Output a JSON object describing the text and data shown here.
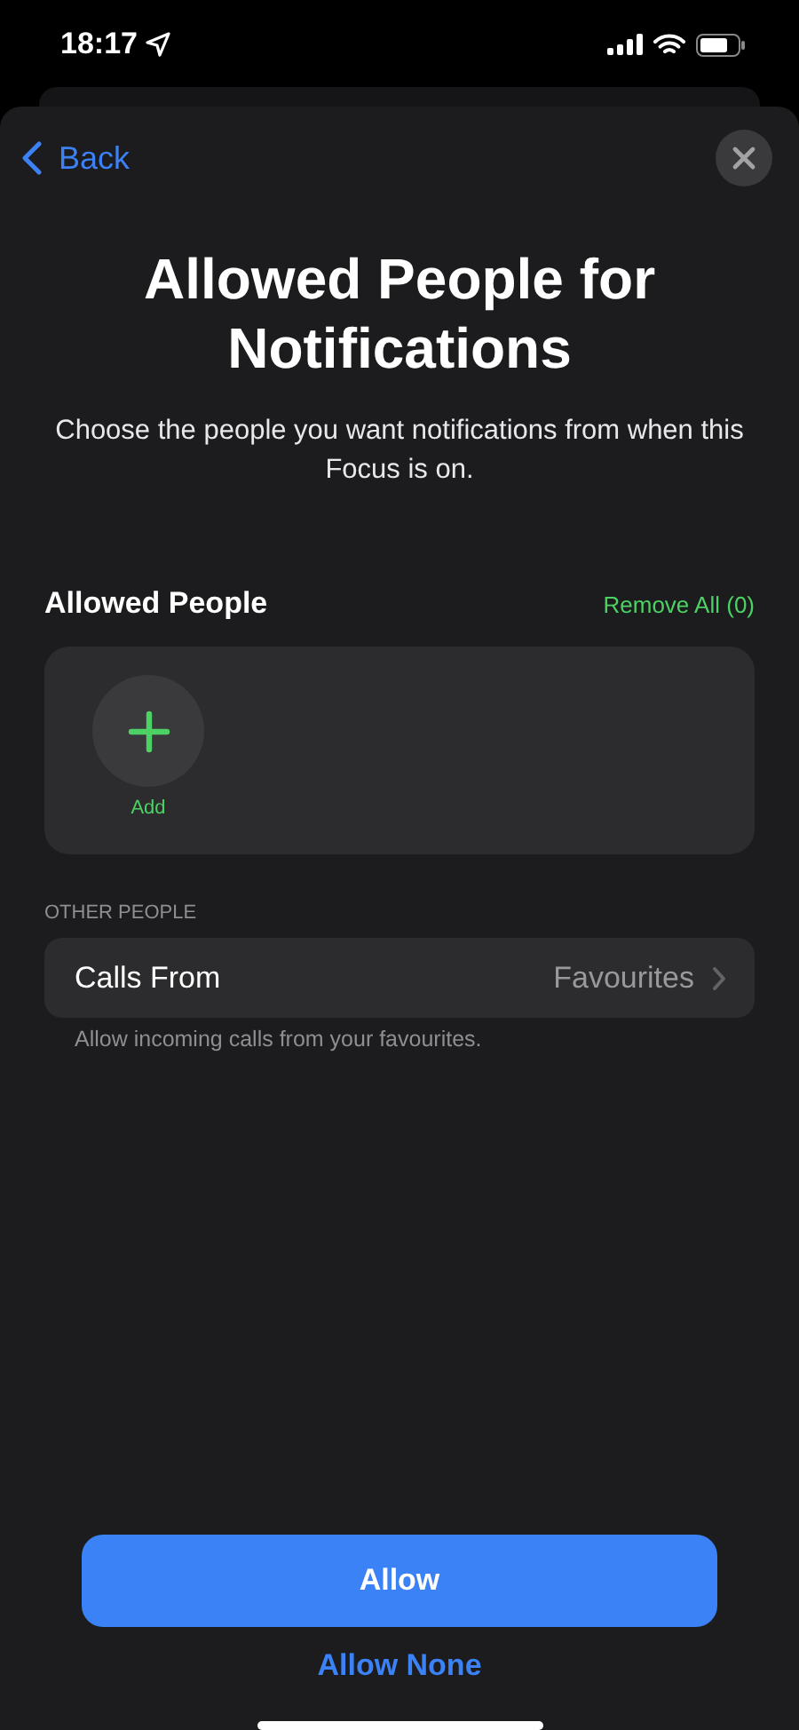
{
  "status_bar": {
    "time": "18:17"
  },
  "nav": {
    "back": "Back"
  },
  "title": "Allowed People for Notifications",
  "subtitle": "Choose the people you want notifications from when this Focus is on.",
  "allowed_people": {
    "header": "Allowed People",
    "action": "Remove All (0)",
    "add_label": "Add"
  },
  "other_people": {
    "header": "OTHER PEOPLE",
    "rows": [
      {
        "label": "Calls From",
        "value": "Favourites"
      }
    ],
    "footer": "Allow incoming calls from your favourites."
  },
  "buttons": [
    {
      "kind": "primary",
      "label": "Allow"
    },
    {
      "kind": "plain",
      "label": "Allow None"
    }
  ]
}
